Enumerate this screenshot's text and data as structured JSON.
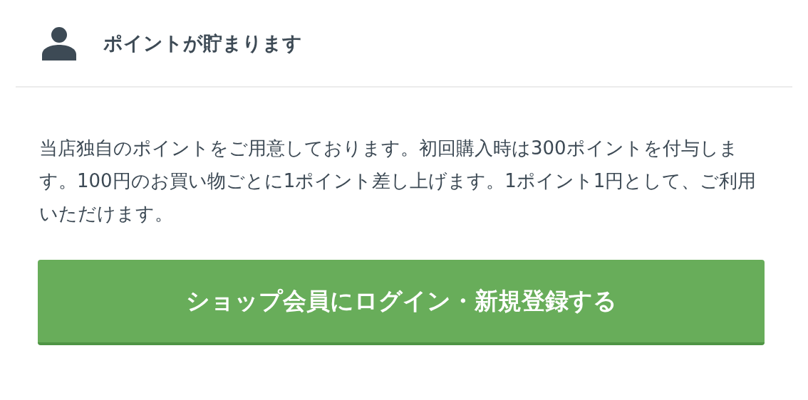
{
  "header": {
    "title": "ポイントが貯まります"
  },
  "description": "当店独自のポイントをご用意しております。初回購入時は300ポイントを付与します。100円のお買い物ごとに1ポイント差し上げます。1ポイント1円として、ご利用いただけます。",
  "button": {
    "label": "ショップ会員にログイン・新規登録する"
  }
}
